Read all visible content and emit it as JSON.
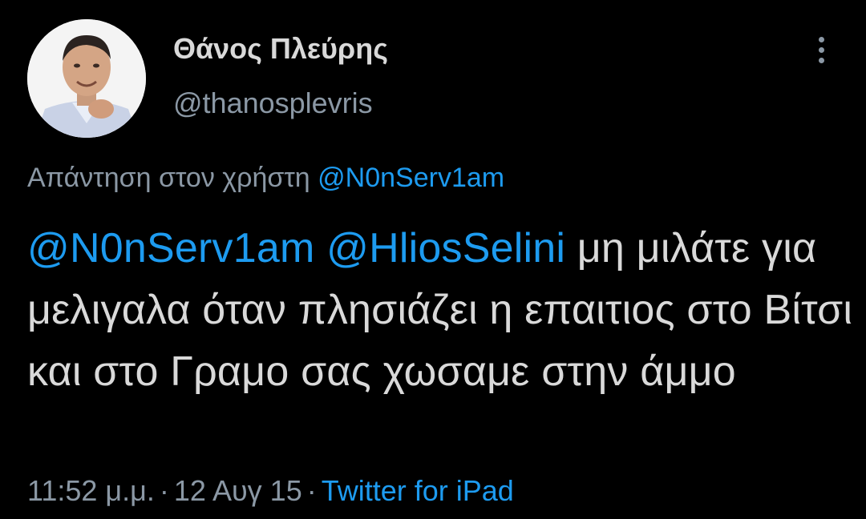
{
  "author": {
    "display_name": "Θάνος Πλεύρης",
    "handle": "@thanosplevris"
  },
  "reply_context": {
    "prefix": "Απάντηση στον χρήστη",
    "mention": "@N0nServ1am"
  },
  "tweet": {
    "mention_1": "@N0nServ1am",
    "mention_2": "@HliosSelini",
    "body": "μη μιλάτε για μελιγαλα όταν πλησιάζει η επαιτιος στο Βίτσι και στο Γραμο σας χωσαμε στην άμμο"
  },
  "meta": {
    "time": "11:52 μ.μ.",
    "separator": "·",
    "date": "12 Αυγ 15",
    "source": "Twitter for iPad"
  },
  "icons": {
    "more": "more-vertical-icon"
  },
  "colors": {
    "background": "#000000",
    "text": "#d9d9d9",
    "secondary": "#8b98a5",
    "link": "#1d9bf0"
  }
}
